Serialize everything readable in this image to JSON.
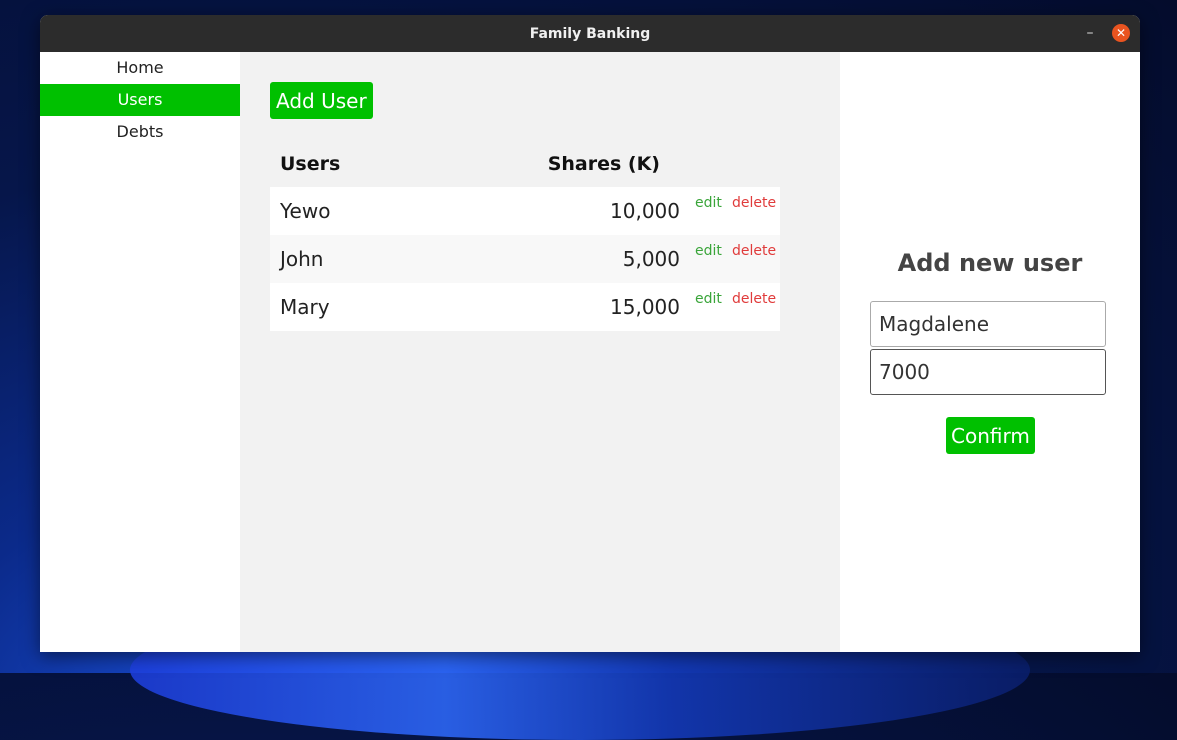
{
  "window": {
    "title": "Family Banking",
    "minimize_glyph": "–",
    "close_glyph": "✕"
  },
  "sidebar": {
    "items": [
      {
        "label": "Home",
        "active": false
      },
      {
        "label": "Users",
        "active": true
      },
      {
        "label": "Debts",
        "active": false
      }
    ]
  },
  "main": {
    "add_button_label": "Add User",
    "table": {
      "headers": {
        "users": "Users",
        "shares": "Shares (K)"
      },
      "rows": [
        {
          "name": "Yewo",
          "shares": "10,000",
          "edit": "edit",
          "delete": "delete"
        },
        {
          "name": "John",
          "shares": "5,000",
          "edit": "edit",
          "delete": "delete"
        },
        {
          "name": "Mary",
          "shares": "15,000",
          "edit": "edit",
          "delete": "delete"
        }
      ]
    }
  },
  "form": {
    "heading": "Add new user",
    "name_value": "Magdalene",
    "shares_value": "7000",
    "confirm_label": "Confirm"
  },
  "colors": {
    "accent": "#00c000",
    "edit": "#3aa53a",
    "delete": "#e03b3b",
    "close": "#e95420"
  }
}
